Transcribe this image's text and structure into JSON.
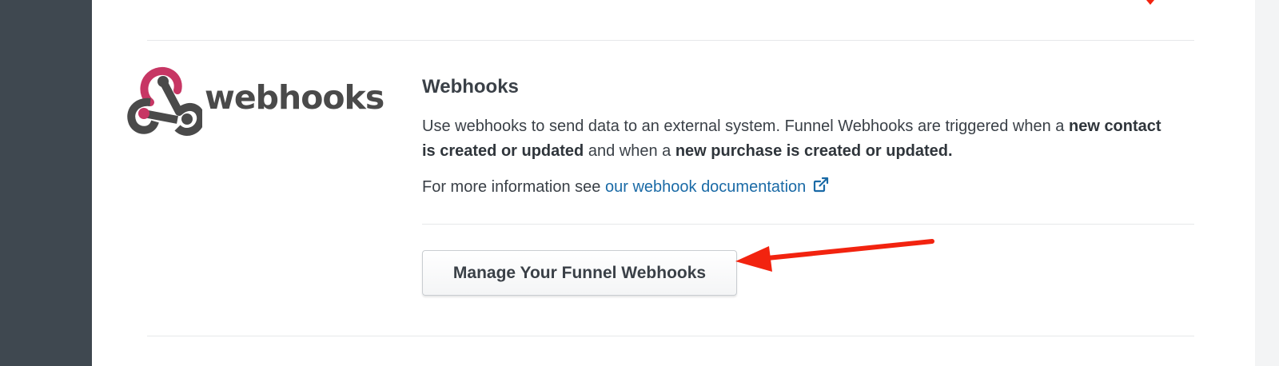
{
  "section": {
    "logo_word": "webhooks",
    "title": "Webhooks",
    "description": {
      "part1": "Use webhooks to send data to an external system. Funnel Webhooks are triggered when a ",
      "bold1": "new contact is created or updated",
      "part2": " and when a ",
      "bold2": "new purchase is created or updated."
    },
    "info_prefix": "For more information see ",
    "doc_link_label": "our webhook documentation",
    "external_link_icon": "external-link-icon",
    "manage_button_label": "Manage Your Funnel Webhooks"
  },
  "colors": {
    "sidebar": "#3f4850",
    "logo_red": "#c73664",
    "logo_gray": "#4a4a4a",
    "link": "#1a6aa6",
    "annotation_arrow": "#f2230f"
  }
}
